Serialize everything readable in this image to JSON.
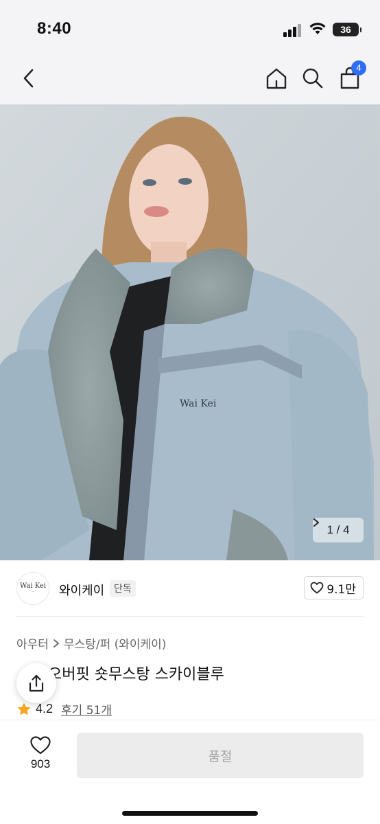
{
  "status_bar": {
    "time": "8:40",
    "battery": "36",
    "icons": [
      "cellular-signal-icon",
      "wifi-icon",
      "battery-icon"
    ]
  },
  "nav": {
    "icons": [
      "back-chevron-icon",
      "home-icon",
      "search-icon",
      "shopping-bag-icon"
    ],
    "cart_count": "4"
  },
  "hero": {
    "image_desc": "model wearing sky blue suede fur-collar mustang jacket",
    "jacket_print": "Wai Kei",
    "page_current": "1",
    "page_separator": "/",
    "page_total": "4",
    "page_label": "1 / 4"
  },
  "brand": {
    "logo_text": "Wai Kei",
    "name": "와이케이",
    "tag": "단독",
    "like_count": "9.1만"
  },
  "product": {
    "breadcrumb": [
      "아우터",
      "무스탕/퍼 (와이케이)"
    ],
    "title_partial": "오버핏 숏무스탕 스카이블루",
    "rating": "4.2",
    "review_label": "후기 51개"
  },
  "bottom_bar": {
    "wish_count": "903",
    "buy_label": "품절"
  },
  "colors": {
    "accent": "#2f6ef2",
    "star": "#f5a623",
    "disabled_bg": "#ececec",
    "disabled_text": "#a3a3a3"
  }
}
